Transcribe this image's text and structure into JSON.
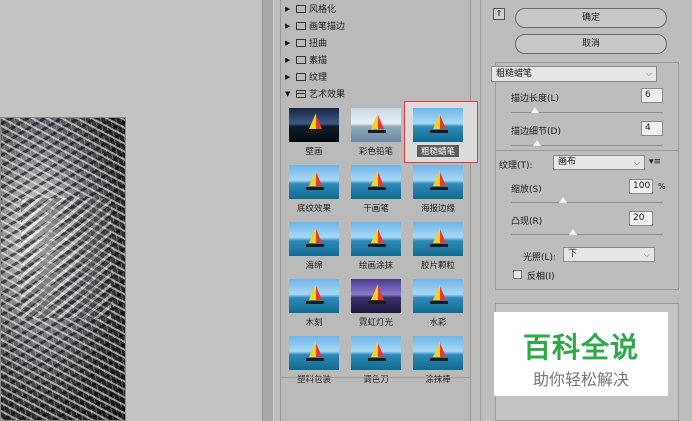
{
  "gallery": {
    "categories_closed": [
      {
        "label": "风格化"
      },
      {
        "label": "画笔描边"
      },
      {
        "label": "扭曲"
      },
      {
        "label": "素描"
      },
      {
        "label": "纹理"
      }
    ],
    "category_open": {
      "label": "艺术效果"
    },
    "thumbnails": [
      {
        "label": "壁画"
      },
      {
        "label": "彩色铅笔"
      },
      {
        "label": "粗糙蜡笔"
      },
      {
        "label": "底纹效果"
      },
      {
        "label": "干画笔"
      },
      {
        "label": "海报边缘"
      },
      {
        "label": "海绵"
      },
      {
        "label": "绘画涂抹"
      },
      {
        "label": "胶片颗粒"
      },
      {
        "label": "木刻"
      },
      {
        "label": "霓虹灯光"
      },
      {
        "label": "水彩"
      },
      {
        "label": "塑料包装"
      },
      {
        "label": "调色刀"
      },
      {
        "label": "涂抹棒"
      }
    ],
    "selected_index": 2
  },
  "panel": {
    "ok_label": "确定",
    "cancel_label": "取消",
    "filter_select": "粗糙蜡笔",
    "stroke_length_label": "描边长度(L)",
    "stroke_length_value": "6",
    "stroke_detail_label": "描边细节(D)",
    "stroke_detail_value": "4",
    "texture_label": "纹理(T):",
    "texture_value": "画布",
    "scaling_label": "缩放(S)",
    "scaling_value": "100",
    "scaling_unit": "%",
    "relief_label": "凸现(R)",
    "relief_value": "20",
    "light_label": "光照(L):",
    "light_value": "下",
    "invert_label": "反相(I)"
  },
  "watermark": {
    "title": "百科全说",
    "subtitle": "助你轻松解决"
  }
}
